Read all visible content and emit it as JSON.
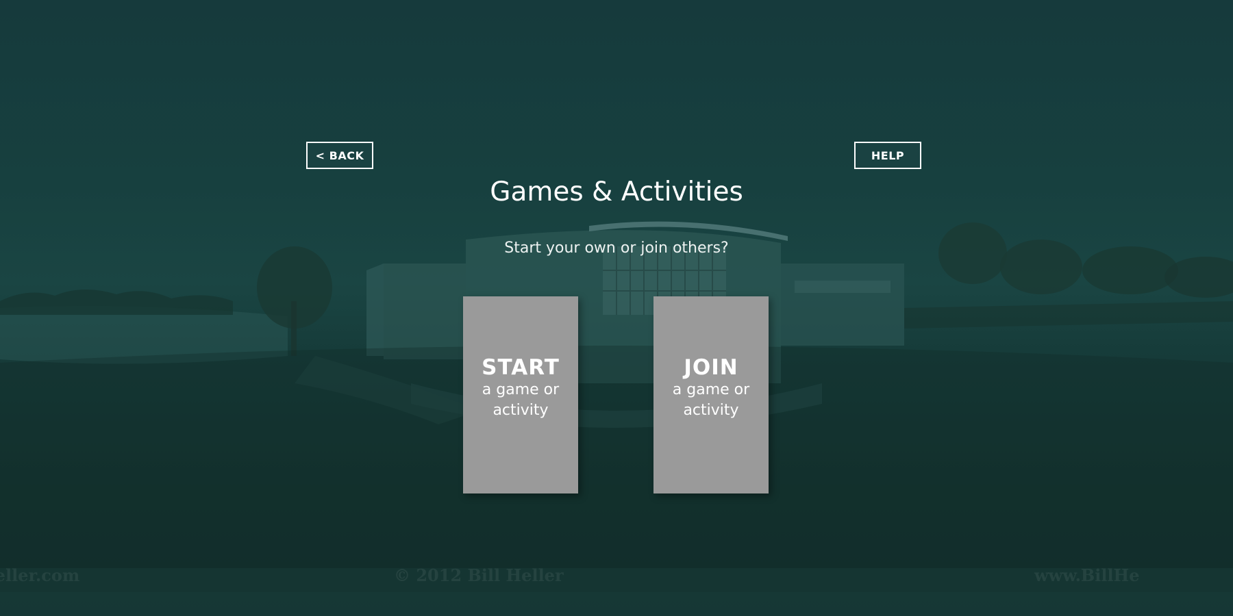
{
  "header": {
    "back_label": "< BACK",
    "help_label": "HELP",
    "title": "Games & Activities",
    "subtitle": "Start your own or join others?"
  },
  "tiles": [
    {
      "head": "START",
      "sub": "a game or activity"
    },
    {
      "head": "JOIN",
      "sub": "a game or activity"
    }
  ],
  "background": {
    "watermark_left": "Heller.com",
    "watermark_center": "© 2012 Bill Heller",
    "watermark_right": "www.BillHe"
  },
  "colors": {
    "overlay": "#163f40",
    "tile": "#9a9a9a",
    "text": "#ffffff"
  }
}
